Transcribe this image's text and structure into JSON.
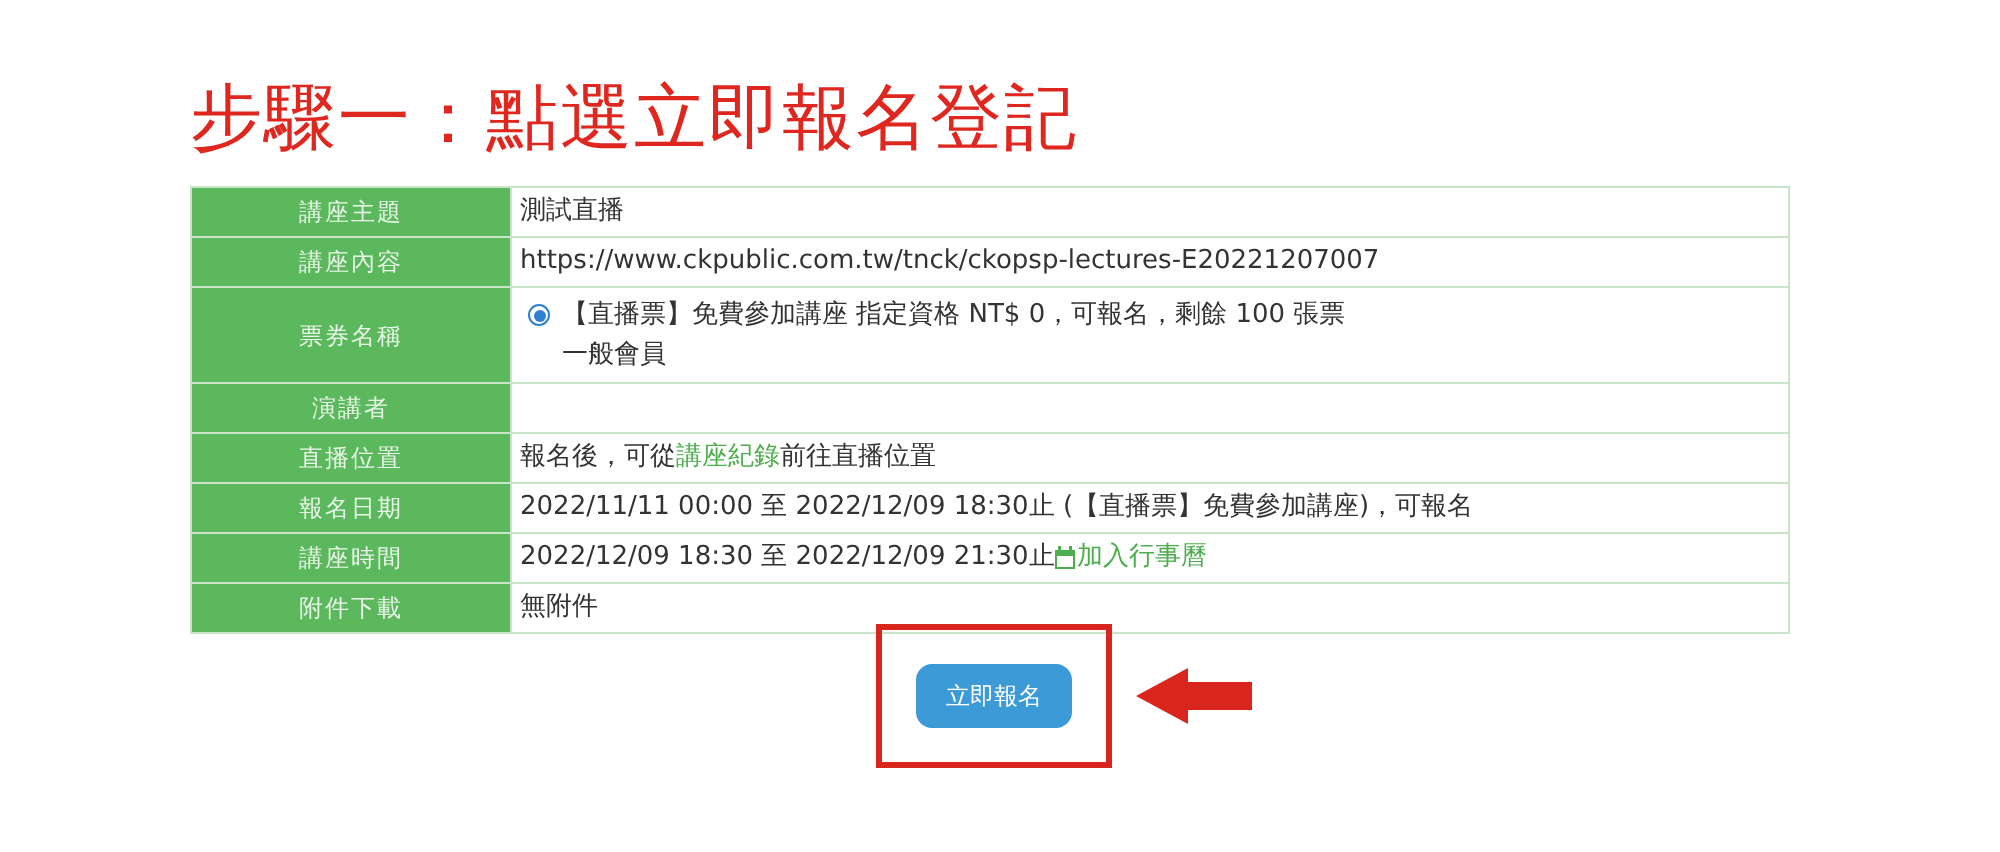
{
  "heading": "步驟一：點選立即報名登記",
  "rows": [
    {
      "label": "講座主題",
      "kind": "text",
      "value": "測試直播"
    },
    {
      "label": "講座內容",
      "kind": "text",
      "value": "https://www.ckpublic.com.tw/tnck/ckopsp-lectures-E20221207007"
    },
    {
      "label": "票券名稱",
      "kind": "radio",
      "selected": true,
      "lines": [
        "【直播票】免費參加講座 指定資格 NT$ 0，可報名，剩餘 100 張票",
        "一般會員"
      ]
    },
    {
      "label": "演講者",
      "kind": "empty"
    },
    {
      "label": "直播位置",
      "kind": "segments",
      "parts": [
        {
          "kind": "text",
          "text": "報名後，可從"
        },
        {
          "kind": "link",
          "text": "講座紀錄"
        },
        {
          "kind": "text",
          "text": "前往直播位置"
        }
      ]
    },
    {
      "label": "報名日期",
      "kind": "text",
      "value": "2022/11/11 00:00 至 2022/12/09 18:30止 (【直播票】免費參加講座)，可報名"
    },
    {
      "label": "講座時間",
      "kind": "segments",
      "parts": [
        {
          "kind": "text",
          "text": "2022/12/09 18:30 至 2022/12/09 21:30止"
        },
        {
          "kind": "calendar_link",
          "text": "加入行事曆"
        }
      ]
    },
    {
      "label": "附件下載",
      "kind": "text",
      "value": "無附件"
    }
  ],
  "button": "立即報名"
}
